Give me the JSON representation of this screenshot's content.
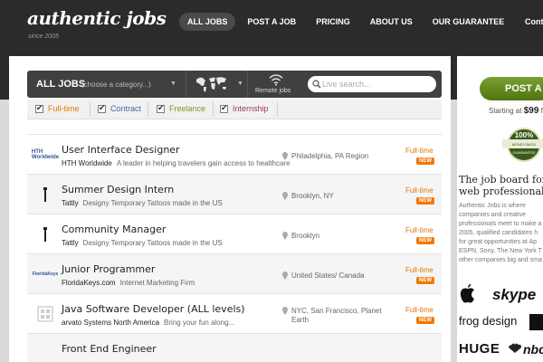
{
  "header": {
    "logo": "authentic jobs",
    "tagline": "since 2005",
    "nav": [
      {
        "label": "ALL JOBS",
        "active": true
      },
      {
        "label": "POST A JOB"
      },
      {
        "label": "PRICING"
      },
      {
        "label": "ABOUT US"
      },
      {
        "label": "OUR GUARANTEE"
      }
    ],
    "contact": "Conta"
  },
  "filters": {
    "all_jobs": "ALL JOBS",
    "category_placeholder": "(choose a category...)",
    "remote_label": "Remote jobs",
    "search_placeholder": "Live search...",
    "types": [
      {
        "label": "Full-time",
        "color": "#e07800"
      },
      {
        "label": "Contract",
        "color": "#3a6ea5"
      },
      {
        "label": "Freelance",
        "color": "#7a9a20"
      },
      {
        "label": "Internship",
        "color": "#9a3a6a"
      }
    ]
  },
  "jobs": [
    {
      "logo": "HTH Worldwide",
      "title": "User Interface Designer",
      "company": "HTH Worldwide",
      "desc": "A leader in helping travelers gain access to healthcare",
      "location": "Philadelphia, PA Region",
      "type": "Full-time",
      "badge": "NEW"
    },
    {
      "logo": "",
      "title": "Summer Design Intern",
      "company": "Tattly",
      "desc": "Designy Temporary Tattoos made in the US",
      "location": "Brooklyn, NY",
      "type": "Full-time",
      "badge": "NEW"
    },
    {
      "logo": "",
      "title": "Community Manager",
      "company": "Tattly",
      "desc": "Designy Temporary Tattoos made in the US",
      "location": "Brooklyn",
      "type": "Full-time",
      "badge": "NEW"
    },
    {
      "logo": "FloridaKeys",
      "title": "Junior Programmer",
      "company": "FloridaKeys.com",
      "desc": "Internet Marketing Firm",
      "location": "United States/ Canada",
      "type": "Full-time",
      "badge": "NEW"
    },
    {
      "logo": "",
      "title": "Java Software Developer (ALL levels)",
      "company": "arvato Systems North America",
      "desc": "Bring your fun along...",
      "location": "NYC, San Francisco, Planet Earth",
      "type": "Full-time",
      "badge": "NEW"
    },
    {
      "logo": "",
      "title": "Front End Engineer",
      "company": "",
      "desc": "",
      "location": "",
      "type": "",
      "badge": ""
    }
  ],
  "sidebar": {
    "post_button": "POST A JO",
    "price_prefix": "Starting at",
    "price": "$99",
    "price_suffix": "fo",
    "seal": "100% MONEY-BACK GUARANTEE",
    "heading_line1": "The job board for",
    "heading_line2": "web professionals.",
    "text": "Authentic Jobs is where\ncompanies and creative\nprofessionals meet to make a\n2005, qualified candidates h\nfor great opportunities at Ap\nESPN, Sony, The New York T\nother companies big and sma",
    "brands": [
      "skype",
      "frog design",
      "HUGE",
      "nbc"
    ]
  }
}
